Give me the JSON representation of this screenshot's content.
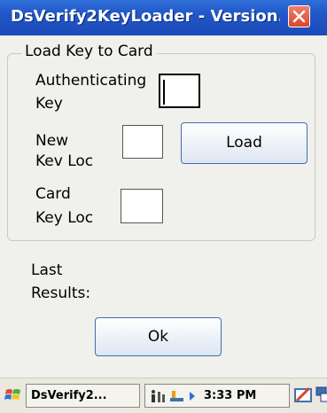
{
  "window": {
    "title": "DsVerify2KeyLoader - Version..."
  },
  "group": {
    "title": "Load Key to Card"
  },
  "fields": {
    "auth_key_label_1": "Authenticating",
    "auth_key_label_2": "Key",
    "new_key_loc_label_1": "New",
    "new_key_loc_label_2": "Kev Loc",
    "card_key_loc_label_1": "Card",
    "card_key_loc_label_2": "Key Loc"
  },
  "buttons": {
    "load": "Load",
    "ok": "Ok"
  },
  "results": {
    "label_1": "Last",
    "label_2": "Results:"
  },
  "taskbar": {
    "task": "DsVerify2...",
    "time": "3:33 PM"
  }
}
